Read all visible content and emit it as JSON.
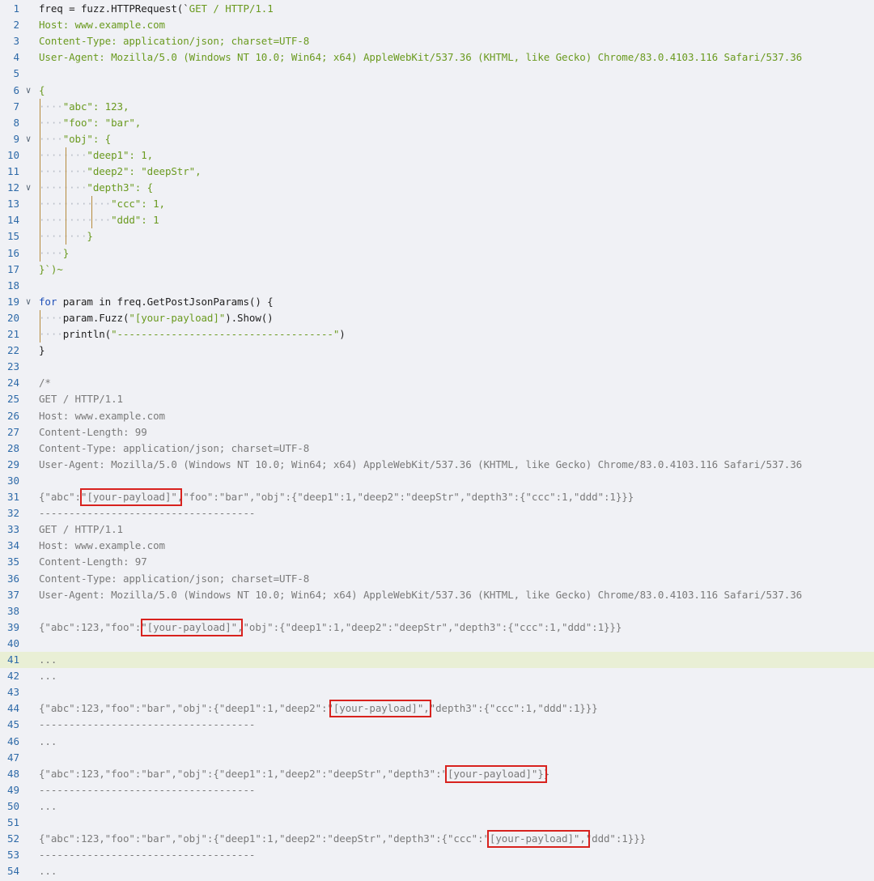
{
  "editor": {
    "highlighted_line": 41,
    "folded_lines": [
      6,
      9,
      12,
      19
    ],
    "fold_icon": "chevron-down-icon",
    "colors": {
      "background": "#f0f1f5",
      "line_number": "#2e6aa8",
      "string": "#6a9a1f",
      "keyword": "#1e4fb8",
      "comment": "#7a7a7a",
      "highlight": "#e9efd5",
      "annotation_box": "#d8221e"
    },
    "lines": [
      {
        "n": "1",
        "ind": "",
        "text": "freq = fuzz.HTTPRequest(`GET / HTTP/1.1",
        "kind": "fn"
      },
      {
        "n": "2",
        "ind": "",
        "text": "Host: www.example.com",
        "kind": "str"
      },
      {
        "n": "3",
        "ind": "",
        "text": "Content-Type: application/json; charset=UTF-8",
        "kind": "str"
      },
      {
        "n": "4",
        "ind": "",
        "text": "User-Agent: Mozilla/5.0 (Windows NT 10.0; Win64; x64) AppleWebKit/537.36 (KHTML, like Gecko) Chrome/83.0.4103.116 Safari/537.36",
        "kind": "str"
      },
      {
        "n": "5",
        "ind": "",
        "text": "",
        "kind": "str"
      },
      {
        "n": "6",
        "ind": "",
        "text": "{",
        "kind": "str"
      },
      {
        "n": "7",
        "ind": "····",
        "text": "\"abc\": 123,",
        "kind": "str"
      },
      {
        "n": "8",
        "ind": "····",
        "text": "\"foo\": \"bar\",",
        "kind": "str"
      },
      {
        "n": "9",
        "ind": "····",
        "text": "\"obj\": {",
        "kind": "str"
      },
      {
        "n": "10",
        "ind": "········",
        "text": "\"deep1\": 1,",
        "kind": "str"
      },
      {
        "n": "11",
        "ind": "········",
        "text": "\"deep2\": \"deepStr\",",
        "kind": "str"
      },
      {
        "n": "12",
        "ind": "········",
        "text": "\"depth3\": {",
        "kind": "str"
      },
      {
        "n": "13",
        "ind": "············",
        "text": "\"ccc\": 1,",
        "kind": "str"
      },
      {
        "n": "14",
        "ind": "············",
        "text": "\"ddd\": 1",
        "kind": "str"
      },
      {
        "n": "15",
        "ind": "········",
        "text": "}",
        "kind": "str"
      },
      {
        "n": "16",
        "ind": "····",
        "text": "}",
        "kind": "str"
      },
      {
        "n": "17",
        "ind": "",
        "text": "}`)~",
        "kind": "str"
      },
      {
        "n": "18",
        "ind": "",
        "text": "",
        "kind": "str"
      },
      {
        "n": "19",
        "ind": "",
        "text": "for param in freq.GetPostJsonParams() {",
        "kind": "kw"
      },
      {
        "n": "20",
        "ind": "····",
        "text": "param.Fuzz(\"[your-payload]\").Show()",
        "kind": "fn"
      },
      {
        "n": "21",
        "ind": "····",
        "text": "println(\"------------------------------------\")",
        "kind": "fn"
      },
      {
        "n": "22",
        "ind": "",
        "text": "}",
        "kind": "fn"
      },
      {
        "n": "23",
        "ind": "",
        "text": "",
        "kind": "cmt"
      },
      {
        "n": "24",
        "ind": "",
        "text": "/*",
        "kind": "cmt"
      },
      {
        "n": "25",
        "ind": "",
        "text": "GET / HTTP/1.1",
        "kind": "cmt"
      },
      {
        "n": "26",
        "ind": "",
        "text": "Host: www.example.com",
        "kind": "cmt"
      },
      {
        "n": "27",
        "ind": "",
        "text": "Content-Length: 99",
        "kind": "cmt"
      },
      {
        "n": "28",
        "ind": "",
        "text": "Content-Type: application/json; charset=UTF-8",
        "kind": "cmt"
      },
      {
        "n": "29",
        "ind": "",
        "text": "User-Agent: Mozilla/5.0 (Windows NT 10.0; Win64; x64) AppleWebKit/537.36 (KHTML, like Gecko) Chrome/83.0.4103.116 Safari/537.36",
        "kind": "cmt"
      },
      {
        "n": "30",
        "ind": "",
        "text": "",
        "kind": "cmt"
      },
      {
        "n": "31",
        "ind": "",
        "text": "{\"abc\":\"[your-payload]\",\"foo\":\"bar\",\"obj\":{\"deep1\":1,\"deep2\":\"deepStr\",\"depth3\":{\"ccc\":1,\"ddd\":1}}}",
        "kind": "cmt"
      },
      {
        "n": "32",
        "ind": "",
        "text": "------------------------------------",
        "kind": "cmt"
      },
      {
        "n": "33",
        "ind": "",
        "text": "GET / HTTP/1.1",
        "kind": "cmt"
      },
      {
        "n": "34",
        "ind": "",
        "text": "Host: www.example.com",
        "kind": "cmt"
      },
      {
        "n": "35",
        "ind": "",
        "text": "Content-Length: 97",
        "kind": "cmt"
      },
      {
        "n": "36",
        "ind": "",
        "text": "Content-Type: application/json; charset=UTF-8",
        "kind": "cmt"
      },
      {
        "n": "37",
        "ind": "",
        "text": "User-Agent: Mozilla/5.0 (Windows NT 10.0; Win64; x64) AppleWebKit/537.36 (KHTML, like Gecko) Chrome/83.0.4103.116 Safari/537.36",
        "kind": "cmt"
      },
      {
        "n": "38",
        "ind": "",
        "text": "",
        "kind": "cmt"
      },
      {
        "n": "39",
        "ind": "",
        "text": "{\"abc\":123,\"foo\":\"[your-payload]\",\"obj\":{\"deep1\":1,\"deep2\":\"deepStr\",\"depth3\":{\"ccc\":1,\"ddd\":1}}}",
        "kind": "cmt"
      },
      {
        "n": "40",
        "ind": "",
        "text": "",
        "kind": "cmt"
      },
      {
        "n": "41",
        "ind": "",
        "text": "...",
        "kind": "cmt"
      },
      {
        "n": "42",
        "ind": "",
        "text": "...",
        "kind": "cmt"
      },
      {
        "n": "43",
        "ind": "",
        "text": "",
        "kind": "cmt"
      },
      {
        "n": "44",
        "ind": "",
        "text": "{\"abc\":123,\"foo\":\"bar\",\"obj\":{\"deep1\":1,\"deep2\":\"[your-payload]\",\"depth3\":{\"ccc\":1,\"ddd\":1}}}",
        "kind": "cmt"
      },
      {
        "n": "45",
        "ind": "",
        "text": "------------------------------------",
        "kind": "cmt"
      },
      {
        "n": "46",
        "ind": "",
        "text": "...",
        "kind": "cmt"
      },
      {
        "n": "47",
        "ind": "",
        "text": "",
        "kind": "cmt"
      },
      {
        "n": "48",
        "ind": "",
        "text": "{\"abc\":123,\"foo\":\"bar\",\"obj\":{\"deep1\":1,\"deep2\":\"deepStr\",\"depth3\":\"[your-payload]\"}}",
        "kind": "cmt"
      },
      {
        "n": "49",
        "ind": "",
        "text": "------------------------------------",
        "kind": "cmt"
      },
      {
        "n": "50",
        "ind": "",
        "text": "...",
        "kind": "cmt"
      },
      {
        "n": "51",
        "ind": "",
        "text": "",
        "kind": "cmt"
      },
      {
        "n": "52",
        "ind": "",
        "text": "{\"abc\":123,\"foo\":\"bar\",\"obj\":{\"deep1\":1,\"deep2\":\"deepStr\",\"depth3\":{\"ccc\":\"[your-payload]\",\"ddd\":1}}}",
        "kind": "cmt"
      },
      {
        "n": "53",
        "ind": "",
        "text": "------------------------------------",
        "kind": "cmt"
      },
      {
        "n": "54",
        "ind": "",
        "text": "...",
        "kind": "cmt"
      }
    ]
  }
}
